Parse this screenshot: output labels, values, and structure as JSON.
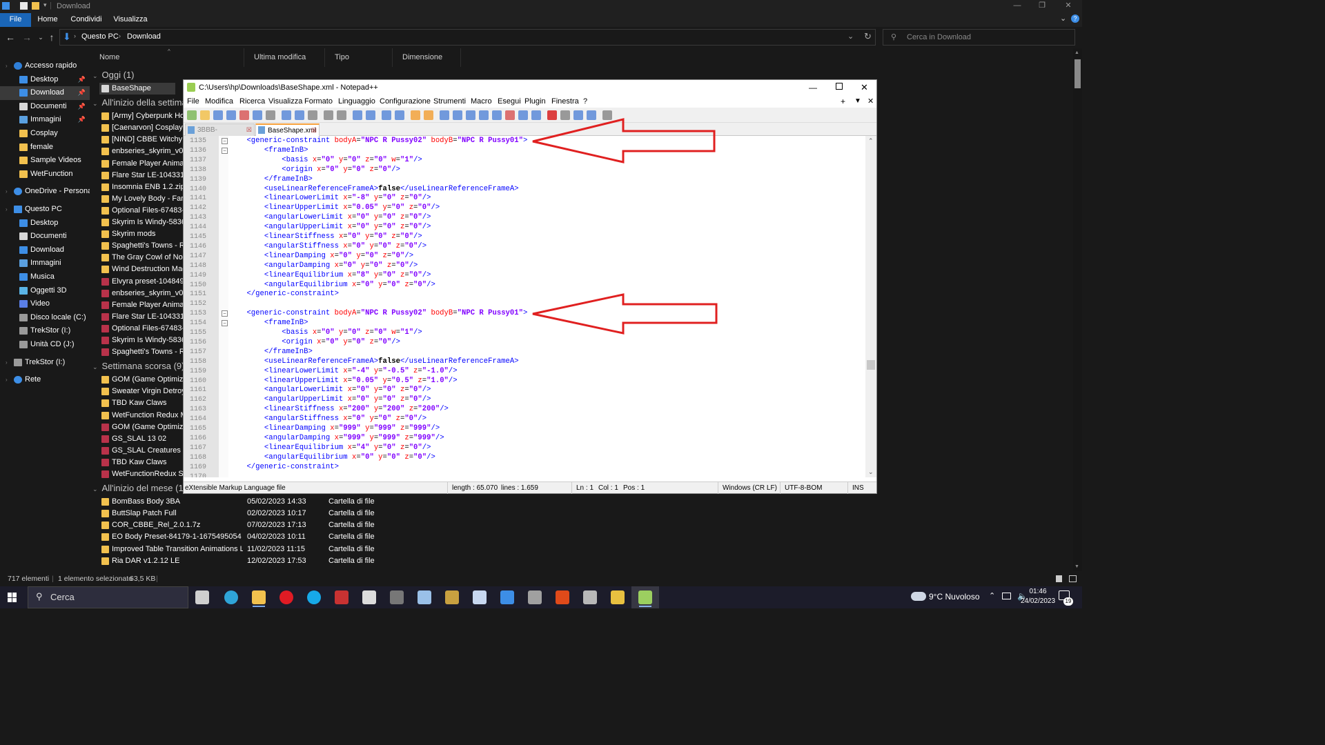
{
  "explorer": {
    "title": "Download",
    "ribbon_tabs": [
      "File",
      "Home",
      "Condividi",
      "Visualizza"
    ],
    "breadcrumb": [
      "Questo PC",
      "Download"
    ],
    "search_placeholder": "Cerca in Download",
    "columns": [
      "Nome",
      "Ultima modifica",
      "Tipo",
      "Dimensione"
    ],
    "sidebar": [
      {
        "label": "Accesso rapido",
        "icon": "star-icon",
        "color": "#2f7fd8",
        "indent": 1,
        "pin": false
      },
      {
        "label": "Desktop",
        "icon": "desktop-icon",
        "color": "#3d8ee6",
        "indent": 2,
        "pin": true
      },
      {
        "label": "Download",
        "icon": "download-icon",
        "color": "#3d8ee6",
        "indent": 2,
        "pin": true,
        "selected": true
      },
      {
        "label": "Documenti",
        "icon": "documents-icon",
        "color": "#d7d7d7",
        "indent": 2,
        "pin": true
      },
      {
        "label": "Immagini",
        "icon": "pictures-icon",
        "color": "#5aa0e0",
        "indent": 2,
        "pin": true
      },
      {
        "label": "Cosplay",
        "icon": "folder-icon",
        "color": "#f2c14e",
        "indent": 2,
        "pin": false
      },
      {
        "label": "female",
        "icon": "folder-icon",
        "color": "#f2c14e",
        "indent": 2,
        "pin": false
      },
      {
        "label": "Sample Videos",
        "icon": "folder-icon",
        "color": "#f2c14e",
        "indent": 2,
        "pin": false
      },
      {
        "label": "WetFunction",
        "icon": "folder-icon",
        "color": "#f2c14e",
        "indent": 2,
        "pin": false
      },
      {
        "label": "OneDrive - Personal",
        "icon": "cloud-icon",
        "color": "#3d8ee6",
        "indent": 1,
        "pin": false,
        "gap": true
      },
      {
        "label": "Questo PC",
        "icon": "pc-icon",
        "color": "#3d8ee6",
        "indent": 1,
        "pin": false,
        "gap": true
      },
      {
        "label": "Desktop",
        "icon": "desktop-icon",
        "color": "#3d8ee6",
        "indent": 2,
        "pin": false
      },
      {
        "label": "Documenti",
        "icon": "documents-icon",
        "color": "#d7d7d7",
        "indent": 2,
        "pin": false
      },
      {
        "label": "Download",
        "icon": "download-icon",
        "color": "#3d8ee6",
        "indent": 2,
        "pin": false
      },
      {
        "label": "Immagini",
        "icon": "pictures-icon",
        "color": "#5aa0e0",
        "indent": 2,
        "pin": false
      },
      {
        "label": "Musica",
        "icon": "music-icon",
        "color": "#3d8ee6",
        "indent": 2,
        "pin": false
      },
      {
        "label": "Oggetti 3D",
        "icon": "objects3d-icon",
        "color": "#5ab4e6",
        "indent": 2,
        "pin": false
      },
      {
        "label": "Video",
        "icon": "video-icon",
        "color": "#5a7ee6",
        "indent": 2,
        "pin": false
      },
      {
        "label": "Disco locale (C:)",
        "icon": "drive-icon",
        "color": "#9a9a9a",
        "indent": 2,
        "pin": false
      },
      {
        "label": "TrekStor (I:)",
        "icon": "usb-drive-icon",
        "color": "#9a9a9a",
        "indent": 2,
        "pin": false
      },
      {
        "label": "Unità CD (J:)",
        "icon": "cd-drive-icon",
        "color": "#9a9a9a",
        "indent": 2,
        "pin": false
      },
      {
        "label": "TrekStor (I:)",
        "icon": "usb-drive-icon",
        "color": "#9a9a9a",
        "indent": 1,
        "pin": false,
        "gap": true
      },
      {
        "label": "Rete",
        "icon": "network-icon",
        "color": "#3d8ee6",
        "indent": 1,
        "pin": false,
        "gap": true
      }
    ],
    "groups": [
      {
        "title": "Oggi (1)",
        "rows": [
          {
            "name": "BaseShape",
            "type": "file",
            "selected": true
          }
        ]
      },
      {
        "title": "All'inizio della settimana",
        "rows": [
          {
            "name": "[Army] Cyberpunk Holo",
            "type": "folder"
          },
          {
            "name": "[Caenarvon] Cosplay Pack",
            "type": "folder"
          },
          {
            "name": "[NIND] CBBE Witchy La",
            "type": "folder"
          },
          {
            "name": "enbseries_skyrim_v0479",
            "type": "folder"
          },
          {
            "name": "Female Player Animation",
            "type": "folder"
          },
          {
            "name": "Flare Star LE-104331-1-1",
            "type": "folder"
          },
          {
            "name": "Insomnia ENB 1.2.zip-11",
            "type": "folder"
          },
          {
            "name": "My Lovely Body - Fanta",
            "type": "folder"
          },
          {
            "name": "Optional Files-67483-",
            "type": "folder"
          },
          {
            "name": "Skyrim Is Windy-5836-4",
            "type": "folder"
          },
          {
            "name": "Skyrim mods",
            "type": "folder"
          },
          {
            "name": "Spaghetti's Towns - Rive",
            "type": "folder"
          },
          {
            "name": "The Gray Cowl of Noctu",
            "type": "folder"
          },
          {
            "name": "Wind Destruction Magic",
            "type": "folder"
          },
          {
            "name": "Elvyra preset-104849-1-",
            "type": "archive"
          },
          {
            "name": "enbseries_skyrim_v0479",
            "type": "archive"
          },
          {
            "name": "Female Player Animation",
            "type": "archive"
          },
          {
            "name": "Flare Star LE-104331-1-1",
            "type": "archive"
          },
          {
            "name": "Optional Files-67483-",
            "type": "archive"
          },
          {
            "name": "Skyrim Is Windy-5836-4",
            "type": "archive"
          },
          {
            "name": "Spaghetti's Towns - Rive",
            "type": "archive"
          }
        ]
      },
      {
        "title": "Settimana scorsa (9)",
        "rows": [
          {
            "name": "GOM (Game Optimizer",
            "type": "folder"
          },
          {
            "name": "Sweater Virgin Detroyer",
            "type": "folder"
          },
          {
            "name": "TBD Kaw Claws",
            "type": "folder"
          },
          {
            "name": "WetFunction Redux Ma",
            "type": "folder"
          },
          {
            "name": "GOM (Game Optimizer",
            "type": "archive"
          },
          {
            "name": "GS_SLAL 13 02",
            "type": "archive"
          },
          {
            "name": "GS_SLAL Creatures 25 1",
            "type": "archive"
          },
          {
            "name": "TBD Kaw Claws",
            "type": "archive"
          },
          {
            "name": "WetFunctionRedux SE",
            "type": "archive"
          }
        ]
      },
      {
        "title": "All'inizio del mese (17)",
        "rows": [
          {
            "name": "BomBass Body 3BA",
            "type": "folder",
            "date": "05/02/2023 14:33",
            "kind": "Cartella di file"
          },
          {
            "name": "ButtSlap Patch Full",
            "type": "folder",
            "date": "02/02/2023 10:17",
            "kind": "Cartella di file"
          },
          {
            "name": "COR_CBBE_Rel_2.0.1.7z",
            "type": "folder",
            "date": "07/02/2023 17:13",
            "kind": "Cartella di file"
          },
          {
            "name": "EO Body Preset-84179-1-1675495054",
            "type": "folder",
            "date": "04/02/2023 10:11",
            "kind": "Cartella di file"
          },
          {
            "name": "Improved Table Transition Animations LE ...",
            "type": "folder",
            "date": "11/02/2023 11:15",
            "kind": "Cartella di file"
          },
          {
            "name": "Ria DAR v1.2.12 LE",
            "type": "folder",
            "date": "12/02/2023 17:53",
            "kind": "Cartella di file"
          }
        ]
      }
    ],
    "status": {
      "count": "717 elementi",
      "selected": "1 elemento selezionato",
      "size": "63,5 KB"
    }
  },
  "notepad": {
    "title": "C:\\Users\\hp\\Downloads\\BaseShape.xml - Notepad++",
    "menu": [
      "File",
      "Modifica",
      "Ricerca",
      "Visualizza",
      "Formato",
      "Linguaggio",
      "Configurazione",
      "Strumenti",
      "Macro",
      "Esegui",
      "Plugin",
      "Finestra",
      "?"
    ],
    "tabs": [
      {
        "label": "3BBB-Amazing.xml",
        "active": false
      },
      {
        "label": "BaseShape.xml",
        "active": true
      }
    ],
    "lines": [
      {
        "n": "1135",
        "t": "    <generic-constraint bodyA=\"NPC R Pussy02\" bodyB=\"NPC R Pussy01\">",
        "fold": "minus"
      },
      {
        "n": "1136",
        "t": "        <frameInB>",
        "fold": "minus"
      },
      {
        "n": "1137",
        "t": "            <basis x=\"0\" y=\"0\" z=\"0\" w=\"1\"/>"
      },
      {
        "n": "1138",
        "t": "            <origin x=\"0\" y=\"0\" z=\"0\"/>"
      },
      {
        "n": "1139",
        "t": "        </frameInB>"
      },
      {
        "n": "1140",
        "t": "        <useLinearReferenceFrameA>false</useLinearReferenceFrameA>"
      },
      {
        "n": "1141",
        "t": "        <linearLowerLimit x=\"-8\" y=\"0\" z=\"0\"/>"
      },
      {
        "n": "1142",
        "t": "        <linearUpperLimit x=\"0.05\" y=\"0\" z=\"0\"/>"
      },
      {
        "n": "1143",
        "t": "        <angularLowerLimit x=\"0\" y=\"0\" z=\"0\"/>"
      },
      {
        "n": "1144",
        "t": "        <angularUpperLimit x=\"0\" y=\"0\" z=\"0\"/>"
      },
      {
        "n": "1145",
        "t": "        <linearStiffness x=\"0\" y=\"0\" z=\"0\"/>"
      },
      {
        "n": "1146",
        "t": "        <angularStiffness x=\"0\" y=\"0\" z=\"0\"/>"
      },
      {
        "n": "1147",
        "t": "        <linearDamping x=\"0\" y=\"0\" z=\"0\"/>"
      },
      {
        "n": "1148",
        "t": "        <angularDamping x=\"0\" y=\"0\" z=\"0\"/>"
      },
      {
        "n": "1149",
        "t": "        <linearEquilibrium x=\"8\" y=\"0\" z=\"0\"/>"
      },
      {
        "n": "1150",
        "t": "        <angularEquilibrium x=\"0\" y=\"0\" z=\"0\"/>"
      },
      {
        "n": "1151",
        "t": "    </generic-constraint>"
      },
      {
        "n": "1152",
        "t": ""
      },
      {
        "n": "1153",
        "t": "    <generic-constraint bodyA=\"NPC R Pussy02\" bodyB=\"NPC R Pussy01\">",
        "fold": "minus"
      },
      {
        "n": "1154",
        "t": "        <frameInB>",
        "fold": "minus"
      },
      {
        "n": "1155",
        "t": "            <basis x=\"0\" y=\"0\" z=\"0\" w=\"1\"/>"
      },
      {
        "n": "1156",
        "t": "            <origin x=\"0\" y=\"0\" z=\"0\"/>"
      },
      {
        "n": "1157",
        "t": "        </frameInB>"
      },
      {
        "n": "1158",
        "t": "        <useLinearReferenceFrameA>false</useLinearReferenceFrameA>"
      },
      {
        "n": "1159",
        "t": "        <linearLowerLimit x=\"-4\" y=\"-0.5\" z=\"-1.0\"/>"
      },
      {
        "n": "1160",
        "t": "        <linearUpperLimit x=\"0.05\" y=\"0.5\" z=\"1.0\"/>"
      },
      {
        "n": "1161",
        "t": "        <angularLowerLimit x=\"0\" y=\"0\" z=\"0\"/>"
      },
      {
        "n": "1162",
        "t": "        <angularUpperLimit x=\"0\" y=\"0\" z=\"0\"/>"
      },
      {
        "n": "1163",
        "t": "        <linearStiffness x=\"200\" y=\"200\" z=\"200\"/>"
      },
      {
        "n": "1164",
        "t": "        <angularStiffness x=\"0\" y=\"0\" z=\"0\"/>"
      },
      {
        "n": "1165",
        "t": "        <linearDamping x=\"999\" y=\"999\" z=\"999\"/>"
      },
      {
        "n": "1166",
        "t": "        <angularDamping x=\"999\" y=\"999\" z=\"999\"/>"
      },
      {
        "n": "1167",
        "t": "        <linearEquilibrium x=\"4\" y=\"0\" z=\"0\"/>"
      },
      {
        "n": "1168",
        "t": "        <angularEquilibrium x=\"0\" y=\"0\" z=\"0\"/>"
      },
      {
        "n": "1169",
        "t": "    </generic-constraint>"
      },
      {
        "n": "1170",
        "t": ""
      }
    ],
    "status": {
      "filetype": "eXtensible Markup Language file",
      "length": "length : 65.070",
      "lines": "lines : 1.659",
      "ln": "Ln : 1",
      "col": "Col : 1",
      "pos": "Pos : 1",
      "eol": "Windows (CR LF)",
      "encoding": "UTF-8-BOM",
      "mode": "INS"
    }
  },
  "taskbar": {
    "search_label": "Cerca",
    "weather": "9°C  Nuvoloso",
    "time": "01:46",
    "date": "24/02/2023",
    "notifications": "19"
  },
  "annotation_color": "#e02020"
}
